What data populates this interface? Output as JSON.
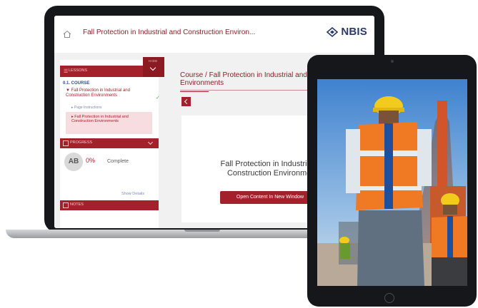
{
  "app": {
    "course_title": "Fall Protection in Industrial and Construction Environ...",
    "brand": "NBIS"
  },
  "sidebar": {
    "header_label": "LESSONS",
    "toggle_label": "HIDE",
    "section_title": "0.1. COURSE",
    "module_title": "▼ Fall Protection in Industrial and Construction Environments",
    "subitem_1": "▸ Page Instructions",
    "subitem_2": "▸ Fall Protection in Industrial and Construction Environments",
    "progress_label": "PROGRESS",
    "avatar_initials": "AB",
    "progress_percent": "0%",
    "progress_status": "Complete",
    "show_details": "Show Details",
    "notes_label": "NOTES"
  },
  "main": {
    "breadcrumb": "Course / Fall Protection in Industrial and Construction Environments",
    "content_title": "Fall Protection in Industrial and Construction Environments",
    "open_button": "Open Content In New Window"
  },
  "colors": {
    "accent": "#a3212a",
    "brand_navy": "#2b3a67"
  }
}
